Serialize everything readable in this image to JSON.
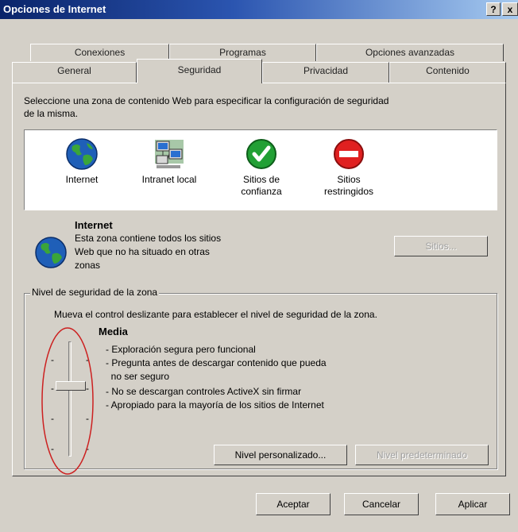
{
  "window": {
    "title": "Opciones de Internet",
    "help_label": "?",
    "close_label": "x"
  },
  "tabs": {
    "row_back": [
      "Conexiones",
      "Programas",
      "Opciones avanzadas"
    ],
    "row_front": [
      "General",
      "Seguridad",
      "Privacidad",
      "Contenido"
    ],
    "active": "Seguridad"
  },
  "security": {
    "intro": "Seleccione una zona de contenido Web para especificar la configuración de seguridad",
    "intro2": "de la misma.",
    "zones": [
      {
        "label": "Internet",
        "label2": "",
        "icon": "globe-icon"
      },
      {
        "label": "Intranet local",
        "label2": "",
        "icon": "network-computers-icon"
      },
      {
        "label": "Sitios de",
        "label2": "confianza",
        "icon": "check-icon"
      },
      {
        "label": "Sitios",
        "label2": "restringidos",
        "icon": "no-entry-icon"
      }
    ],
    "selected_zone": {
      "title": "Internet",
      "desc": [
        "Esta zona contiene todos los sitios",
        "Web que no ha situado en otras",
        "zonas"
      ]
    },
    "sites_button": "Sitios...",
    "level_group": {
      "label": "Nivel de seguridad de la zona",
      "instruction": "Mueva el control deslizante para establecer el nivel de seguridad de la zona.",
      "level_name": "Media",
      "bullets": [
        "- Exploración segura pero funcional",
        "- Pregunta antes de descargar contenido que pueda",
        "  no ser seguro",
        "- No se descargan controles ActiveX sin firmar",
        "- Apropiado para la mayoría de los sitios de Internet"
      ],
      "custom_level_button": "Nivel personalizado...",
      "default_level_button": "Nivel predeterminado"
    }
  },
  "footer": {
    "ok": "Aceptar",
    "cancel": "Cancelar",
    "apply": "Aplicar"
  },
  "colors": {
    "titlebar": "#0a246a",
    "face": "#d4d0c8",
    "annotation": "#cc2020"
  }
}
